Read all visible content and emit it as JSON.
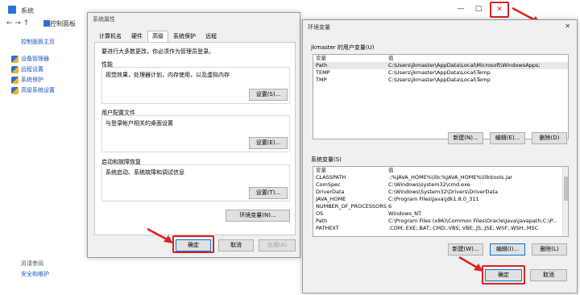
{
  "bg_window": {
    "title": "系统",
    "address": "控制面板",
    "sidebar": {
      "home": "控制面板主页",
      "links": [
        "设备管理器",
        "远程设置",
        "系统保护",
        "高级系统设置"
      ],
      "see_also": "另请参阅",
      "security": "安全和维护"
    },
    "controls": {
      "minimize": "—",
      "maximize": "□",
      "close": "✕"
    }
  },
  "sysprop": {
    "title": "系统属性",
    "tabs": [
      "计算机名",
      "硬件",
      "高级",
      "系统保护",
      "远程"
    ],
    "admin_note": "要进行大多数更改，你必须作为管理员登录。",
    "perf": {
      "label": "性能",
      "desc": "视觉效果，处理器计划，内存使用，以及虚拟内存",
      "button": "设置(S)..."
    },
    "profile": {
      "label": "用户配置文件",
      "desc": "与登录帐户相关的桌面设置",
      "button": "设置(E)..."
    },
    "startup": {
      "label": "启动和故障恢复",
      "desc": "系统启动、系统故障和调试信息",
      "button": "设置(T)..."
    },
    "env_button": "环境变量(N)...",
    "ok": "确定",
    "cancel": "取消",
    "apply": "应用(A)"
  },
  "envvar": {
    "title": "环境变量",
    "close": "✕",
    "user_section": "jkmaster 的用户变量(U)",
    "col_var": "变量",
    "col_val": "值",
    "user_vars": [
      {
        "name": "Path",
        "value": "C:\\Users\\jkmaster\\AppData\\Local\\Microsoft\\WindowsApps;"
      },
      {
        "name": "TEMP",
        "value": "C:\\Users\\jkmaster\\AppData\\Local\\Temp"
      },
      {
        "name": "TMP",
        "value": "C:\\Users\\jkmaster\\AppData\\Local\\Temp"
      }
    ],
    "user_buttons": [
      "新建(N)...",
      "编辑(E)...",
      "删除(D)"
    ],
    "system_section": "系统变量(S)",
    "sys_vars": [
      {
        "name": "CLASSPATH",
        "value": ".;%JAVA_HOME%\\lib;%JAVA_HOME%\\lib\\tools.jar"
      },
      {
        "name": "ComSpec",
        "value": "C:\\Windows\\system32\\cmd.exe"
      },
      {
        "name": "DriverData",
        "value": "C:\\Windows\\System32\\Drivers\\DriverData"
      },
      {
        "name": "JAVA_HOME",
        "value": "C:\\Program Files\\Java\\jdk1.8.0_311"
      },
      {
        "name": "NUMBER_OF_PROCESSORS",
        "value": "6"
      },
      {
        "name": "OS",
        "value": "Windows_NT"
      },
      {
        "name": "Path",
        "value": "C:\\Program Files (x86)\\Common Files\\Oracle\\Java\\javapath;C:\\P..."
      },
      {
        "name": "PATHEXT",
        "value": ".COM;.EXE;.BAT;.CMD;.VBS;.VBE;.JS;.JSE;.WSF;.WSH;.MSC"
      }
    ],
    "sys_buttons": [
      "新建(W)...",
      "编辑(I)...",
      "删除(L)"
    ],
    "ok": "确定",
    "cancel": "取消"
  },
  "colors": {
    "highlight": "#e02020",
    "link": "#1a55c0",
    "accent": "#0078d7"
  }
}
